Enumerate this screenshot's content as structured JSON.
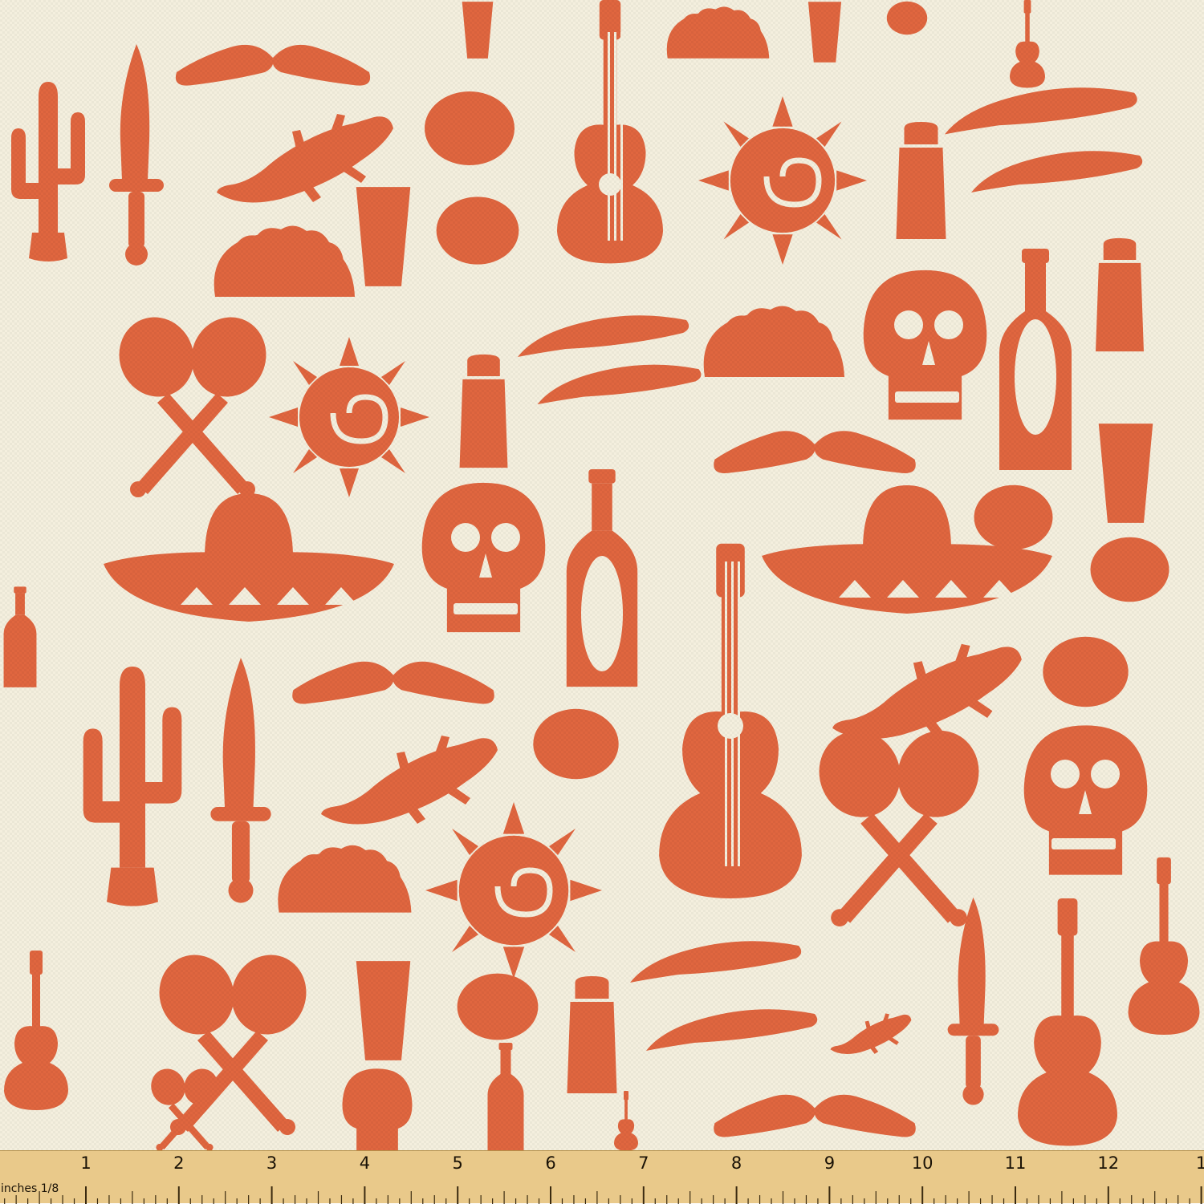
{
  "fabric": {
    "background_color": "#f4efde",
    "motif_color": "#e0663f",
    "motifs": [
      "cactus-icon",
      "dagger-icon",
      "mustache-icon",
      "lizard-icon",
      "taco-icon",
      "shot-glass-icon",
      "lime-slice-icon",
      "guitar-icon",
      "sun-spiral-icon",
      "chili-pepper-icon",
      "salt-shaker-icon",
      "tequila-bottle-icon",
      "sugar-skull-icon",
      "maracas-icon",
      "sombrero-icon",
      "swirl-icon"
    ]
  },
  "ruler": {
    "numbers": [
      "1",
      "2",
      "3",
      "4",
      "5",
      "6",
      "7",
      "8",
      "9",
      "10",
      "11",
      "12",
      "1"
    ],
    "unit_label": "inches 1/8",
    "color": "#e9c98a"
  }
}
